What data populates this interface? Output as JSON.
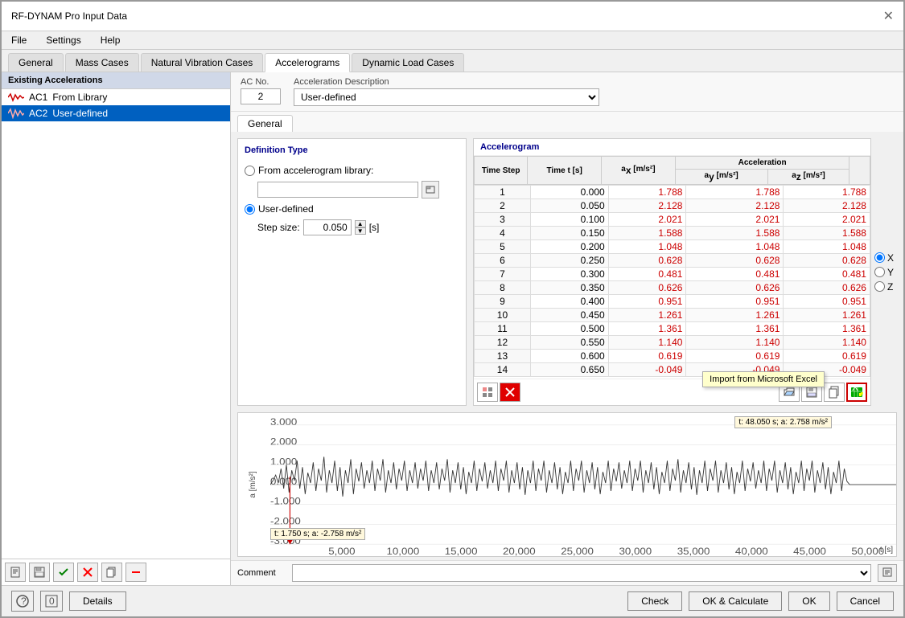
{
  "window": {
    "title": "RF-DYNAM Pro Input Data",
    "close_label": "✕"
  },
  "menu": {
    "items": [
      "File",
      "Settings",
      "Help"
    ]
  },
  "tabs": [
    {
      "label": "General",
      "active": false
    },
    {
      "label": "Mass Cases",
      "active": false
    },
    {
      "label": "Natural Vibration Cases",
      "active": false
    },
    {
      "label": "Accelerograms",
      "active": true
    },
    {
      "label": "Dynamic Load Cases",
      "active": false
    }
  ],
  "sidebar": {
    "header": "Existing Accelerations",
    "items": [
      {
        "id": "AC1",
        "label": "From Library",
        "selected": false
      },
      {
        "id": "AC2",
        "label": "User-defined",
        "selected": true
      }
    ]
  },
  "ac_header": {
    "ac_no_label": "AC No.",
    "ac_no_value": "2",
    "desc_label": "Acceleration Description",
    "desc_value": "User-defined"
  },
  "general_tab": "General",
  "definition": {
    "title": "Definition Type",
    "radio1_label": "From accelerogram library:",
    "radio2_label": "User-defined",
    "step_label": "Step size:",
    "step_value": "0.050",
    "step_unit": "[s]"
  },
  "accelerogram": {
    "title": "Accelerogram",
    "columns": [
      "Time Step",
      "Time t [s]",
      "ax [m/s²]",
      "Acceleration ay [m/s²]",
      "az [m/s²]"
    ],
    "rows": [
      [
        1,
        "0.000",
        "1.788",
        "1.788",
        "1.788"
      ],
      [
        2,
        "0.050",
        "2.128",
        "2.128",
        "2.128"
      ],
      [
        3,
        "0.100",
        "2.021",
        "2.021",
        "2.021"
      ],
      [
        4,
        "0.150",
        "1.588",
        "1.588",
        "1.588"
      ],
      [
        5,
        "0.200",
        "1.048",
        "1.048",
        "1.048"
      ],
      [
        6,
        "0.250",
        "0.628",
        "0.628",
        "0.628"
      ],
      [
        7,
        "0.300",
        "0.481",
        "0.481",
        "0.481"
      ],
      [
        8,
        "0.350",
        "0.626",
        "0.626",
        "0.626"
      ],
      [
        9,
        "0.400",
        "0.951",
        "0.951",
        "0.951"
      ],
      [
        10,
        "0.450",
        "1.261",
        "1.261",
        "1.261"
      ],
      [
        11,
        "0.500",
        "1.361",
        "1.361",
        "1.361"
      ],
      [
        12,
        "0.550",
        "1.140",
        "1.140",
        "1.140"
      ],
      [
        13,
        "0.600",
        "0.619",
        "0.619",
        "0.619"
      ],
      [
        14,
        "0.650",
        "-0.049",
        "-0.049",
        "-0.049"
      ]
    ]
  },
  "chart": {
    "y_label": "a [m/s²]",
    "t_label": "t [s]",
    "tooltip1": "t: 48.050 s; a: 2.758 m/s²",
    "tooltip2": "t: 1.750 s; a: -2.758 m/s²",
    "y_ticks": [
      "3.000",
      "2.000",
      "1.000",
      "0.000",
      "-1.000",
      "-2.000",
      "-3.000"
    ],
    "x_ticks": [
      "5,000",
      "10,000",
      "15,000",
      "20,000",
      "25,000",
      "30,000",
      "35,000",
      "40,000",
      "45,000",
      "50,000"
    ]
  },
  "axis_options": [
    "X",
    "Y",
    "Z"
  ],
  "axis_selected": "X",
  "comment": {
    "label": "Comment",
    "value": ""
  },
  "tooltip": {
    "text": "Import from Microsoft Excel"
  },
  "bottom": {
    "details_label": "Details",
    "check_label": "Check",
    "ok_calc_label": "OK & Calculate",
    "ok_label": "OK",
    "cancel_label": "Cancel"
  }
}
